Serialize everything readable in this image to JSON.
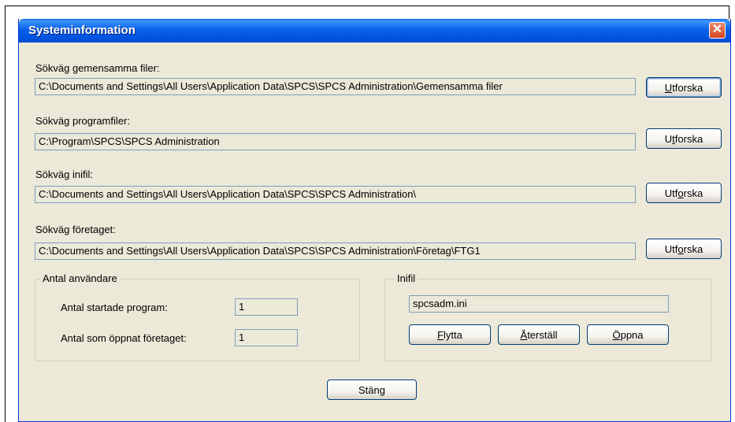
{
  "window": {
    "title": "Systeminformation",
    "close_symbol": "✕"
  },
  "paths": [
    {
      "label": "Sökväg gemensamma filer:",
      "value": "C:\\Documents and Settings\\All Users\\Application Data\\SPCS\\SPCS Administration\\Gemensamma filer",
      "button": {
        "pre": "",
        "ul": "U",
        "post": "tforska"
      }
    },
    {
      "label": "Sökväg programfiler:",
      "value": "C:\\Program\\SPCS\\SPCS Administration",
      "button": {
        "pre": "U",
        "ul": "t",
        "post": "forska"
      }
    },
    {
      "label": "Sökväg inifil:",
      "value": "C:\\Documents and Settings\\All Users\\Application Data\\SPCS\\SPCS Administration\\",
      "button": {
        "pre": "Utf",
        "ul": "o",
        "post": "rska"
      }
    },
    {
      "label": "Sökväg företaget:",
      "value": "C:\\Documents and Settings\\All Users\\Application Data\\SPCS\\SPCS Administration\\Företag\\FTG1",
      "button": {
        "pre": "Utf",
        "ul": "o",
        "post": "rska"
      }
    }
  ],
  "users_group": {
    "title": "Antal användare",
    "started_label": "Antal startade program:",
    "started_value": "1",
    "opened_label": "Antal som öppnat företaget:",
    "opened_value": "1"
  },
  "inifile_group": {
    "title": "Inifil",
    "value": "spcsadm.ini",
    "move": {
      "ul": "F",
      "rest": "lytta"
    },
    "reset": {
      "ul": "Å",
      "rest": "terställ"
    },
    "open": {
      "ul": "Ö",
      "rest": "ppna"
    }
  },
  "close_button": "Stäng"
}
